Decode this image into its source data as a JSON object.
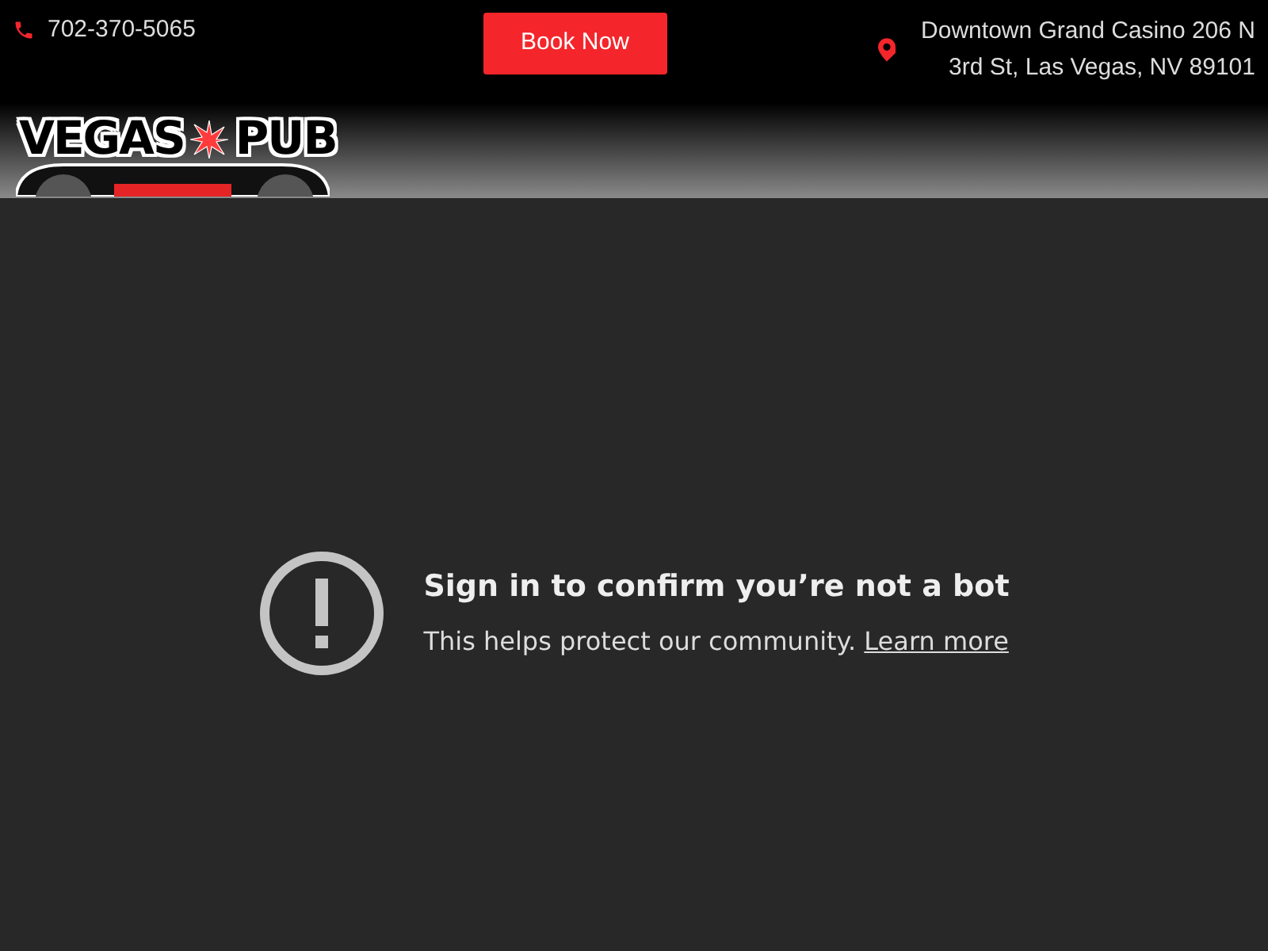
{
  "header": {
    "phone": "702-370-5065",
    "book_button": "Book Now",
    "address_line_1": "Downtown Grand Casino 206 N",
    "address_line_2": "3rd St, Las Vegas, NV 89101"
  },
  "logo": {
    "word_1": "VEGAS",
    "word_2": "PUB"
  },
  "video_error": {
    "title": "Sign in to confirm you’re not a bot",
    "message": "This helps protect our community.",
    "link": "Learn more"
  }
}
